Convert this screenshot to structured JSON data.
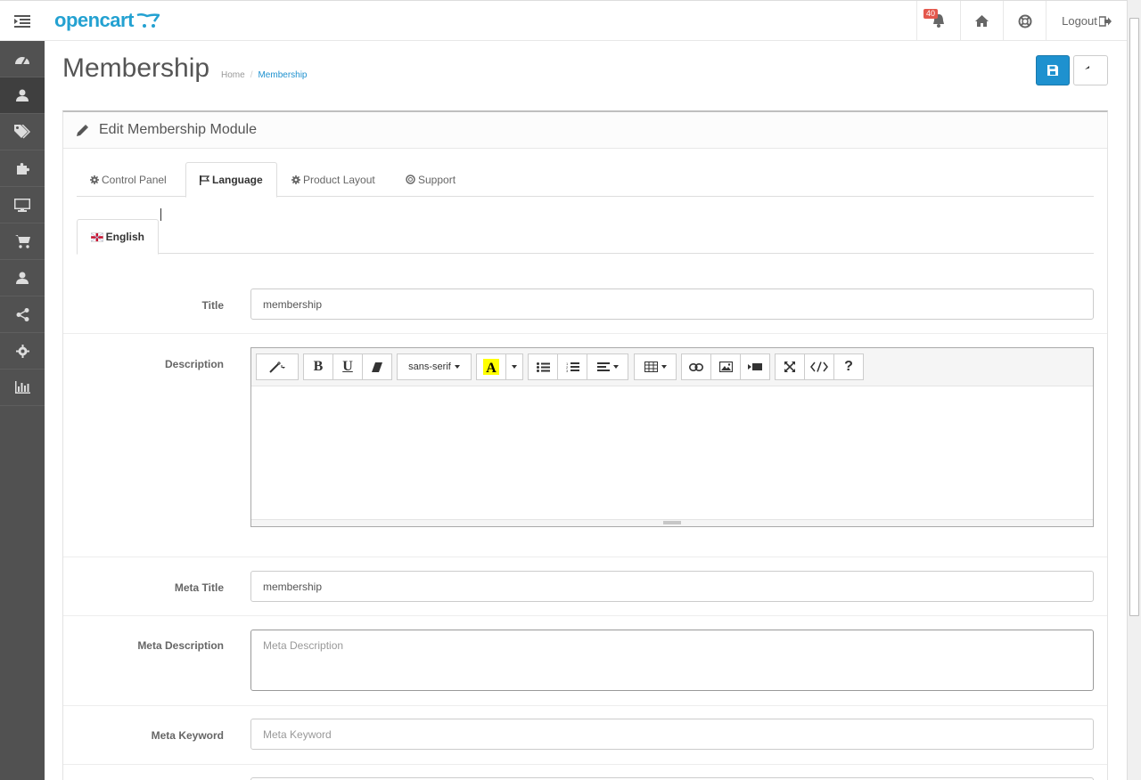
{
  "header": {
    "logo_text": "opencart",
    "alerts_count": "40",
    "logout_label": "Logout"
  },
  "sidebar": {
    "items": [
      {
        "icon": "dashboard-icon"
      },
      {
        "icon": "user-icon",
        "active": true
      },
      {
        "icon": "tags-icon"
      },
      {
        "icon": "puzzle-icon"
      },
      {
        "icon": "desktop-icon"
      },
      {
        "icon": "cart-icon"
      },
      {
        "icon": "customer-icon"
      },
      {
        "icon": "share-icon"
      },
      {
        "icon": "cog-icon"
      },
      {
        "icon": "bar-chart-icon"
      }
    ]
  },
  "page": {
    "title": "Membership",
    "breadcrumb": {
      "home": "Home",
      "current": "Membership"
    }
  },
  "panel": {
    "heading": "Edit Membership Module",
    "tabs": [
      {
        "label": "Control Panel",
        "icon": "cog-icon"
      },
      {
        "label": "Language",
        "icon": "flag-icon",
        "active": true
      },
      {
        "label": "Product Layout",
        "icon": "cog-icon"
      },
      {
        "label": "Support",
        "icon": "life-ring-icon"
      }
    ],
    "language_tab": {
      "label": "English",
      "icon": "uk-flag-icon"
    }
  },
  "form": {
    "title_label": "Title",
    "title_value": "membership",
    "description_label": "Description",
    "editor": {
      "font_name": "sans-serif"
    },
    "meta_title_label": "Meta Title",
    "meta_title_value": "membership",
    "meta_description_label": "Meta Description",
    "meta_description_placeholder": "Meta Description",
    "meta_keyword_label": "Meta Keyword",
    "meta_keyword_placeholder": "Meta Keyword"
  },
  "colors": {
    "accent": "#1e91cf",
    "sidebar_bg": "#515151",
    "badge": "#e4584d"
  }
}
